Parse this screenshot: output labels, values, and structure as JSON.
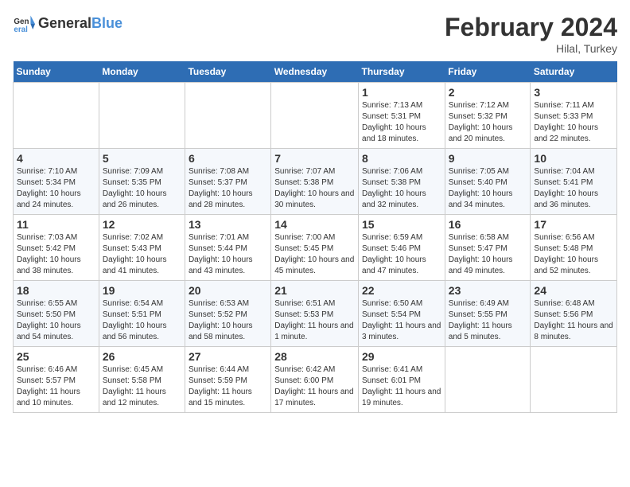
{
  "header": {
    "logo_general": "General",
    "logo_blue": "Blue",
    "month_title": "February 2024",
    "location": "Hilal, Turkey"
  },
  "days_of_week": [
    "Sunday",
    "Monday",
    "Tuesday",
    "Wednesday",
    "Thursday",
    "Friday",
    "Saturday"
  ],
  "weeks": [
    [
      {
        "day": "",
        "sunrise": "",
        "sunset": "",
        "daylight": ""
      },
      {
        "day": "",
        "sunrise": "",
        "sunset": "",
        "daylight": ""
      },
      {
        "day": "",
        "sunrise": "",
        "sunset": "",
        "daylight": ""
      },
      {
        "day": "",
        "sunrise": "",
        "sunset": "",
        "daylight": ""
      },
      {
        "day": "1",
        "sunrise": "Sunrise: 7:13 AM",
        "sunset": "Sunset: 5:31 PM",
        "daylight": "Daylight: 10 hours and 18 minutes."
      },
      {
        "day": "2",
        "sunrise": "Sunrise: 7:12 AM",
        "sunset": "Sunset: 5:32 PM",
        "daylight": "Daylight: 10 hours and 20 minutes."
      },
      {
        "day": "3",
        "sunrise": "Sunrise: 7:11 AM",
        "sunset": "Sunset: 5:33 PM",
        "daylight": "Daylight: 10 hours and 22 minutes."
      }
    ],
    [
      {
        "day": "4",
        "sunrise": "Sunrise: 7:10 AM",
        "sunset": "Sunset: 5:34 PM",
        "daylight": "Daylight: 10 hours and 24 minutes."
      },
      {
        "day": "5",
        "sunrise": "Sunrise: 7:09 AM",
        "sunset": "Sunset: 5:35 PM",
        "daylight": "Daylight: 10 hours and 26 minutes."
      },
      {
        "day": "6",
        "sunrise": "Sunrise: 7:08 AM",
        "sunset": "Sunset: 5:37 PM",
        "daylight": "Daylight: 10 hours and 28 minutes."
      },
      {
        "day": "7",
        "sunrise": "Sunrise: 7:07 AM",
        "sunset": "Sunset: 5:38 PM",
        "daylight": "Daylight: 10 hours and 30 minutes."
      },
      {
        "day": "8",
        "sunrise": "Sunrise: 7:06 AM",
        "sunset": "Sunset: 5:38 PM",
        "daylight": "Daylight: 10 hours and 32 minutes."
      },
      {
        "day": "9",
        "sunrise": "Sunrise: 7:05 AM",
        "sunset": "Sunset: 5:40 PM",
        "daylight": "Daylight: 10 hours and 34 minutes."
      },
      {
        "day": "10",
        "sunrise": "Sunrise: 7:04 AM",
        "sunset": "Sunset: 5:41 PM",
        "daylight": "Daylight: 10 hours and 36 minutes."
      }
    ],
    [
      {
        "day": "11",
        "sunrise": "Sunrise: 7:03 AM",
        "sunset": "Sunset: 5:42 PM",
        "daylight": "Daylight: 10 hours and 38 minutes."
      },
      {
        "day": "12",
        "sunrise": "Sunrise: 7:02 AM",
        "sunset": "Sunset: 5:43 PM",
        "daylight": "Daylight: 10 hours and 41 minutes."
      },
      {
        "day": "13",
        "sunrise": "Sunrise: 7:01 AM",
        "sunset": "Sunset: 5:44 PM",
        "daylight": "Daylight: 10 hours and 43 minutes."
      },
      {
        "day": "14",
        "sunrise": "Sunrise: 7:00 AM",
        "sunset": "Sunset: 5:45 PM",
        "daylight": "Daylight: 10 hours and 45 minutes."
      },
      {
        "day": "15",
        "sunrise": "Sunrise: 6:59 AM",
        "sunset": "Sunset: 5:46 PM",
        "daylight": "Daylight: 10 hours and 47 minutes."
      },
      {
        "day": "16",
        "sunrise": "Sunrise: 6:58 AM",
        "sunset": "Sunset: 5:47 PM",
        "daylight": "Daylight: 10 hours and 49 minutes."
      },
      {
        "day": "17",
        "sunrise": "Sunrise: 6:56 AM",
        "sunset": "Sunset: 5:48 PM",
        "daylight": "Daylight: 10 hours and 52 minutes."
      }
    ],
    [
      {
        "day": "18",
        "sunrise": "Sunrise: 6:55 AM",
        "sunset": "Sunset: 5:50 PM",
        "daylight": "Daylight: 10 hours and 54 minutes."
      },
      {
        "day": "19",
        "sunrise": "Sunrise: 6:54 AM",
        "sunset": "Sunset: 5:51 PM",
        "daylight": "Daylight: 10 hours and 56 minutes."
      },
      {
        "day": "20",
        "sunrise": "Sunrise: 6:53 AM",
        "sunset": "Sunset: 5:52 PM",
        "daylight": "Daylight: 10 hours and 58 minutes."
      },
      {
        "day": "21",
        "sunrise": "Sunrise: 6:51 AM",
        "sunset": "Sunset: 5:53 PM",
        "daylight": "Daylight: 11 hours and 1 minute."
      },
      {
        "day": "22",
        "sunrise": "Sunrise: 6:50 AM",
        "sunset": "Sunset: 5:54 PM",
        "daylight": "Daylight: 11 hours and 3 minutes."
      },
      {
        "day": "23",
        "sunrise": "Sunrise: 6:49 AM",
        "sunset": "Sunset: 5:55 PM",
        "daylight": "Daylight: 11 hours and 5 minutes."
      },
      {
        "day": "24",
        "sunrise": "Sunrise: 6:48 AM",
        "sunset": "Sunset: 5:56 PM",
        "daylight": "Daylight: 11 hours and 8 minutes."
      }
    ],
    [
      {
        "day": "25",
        "sunrise": "Sunrise: 6:46 AM",
        "sunset": "Sunset: 5:57 PM",
        "daylight": "Daylight: 11 hours and 10 minutes."
      },
      {
        "day": "26",
        "sunrise": "Sunrise: 6:45 AM",
        "sunset": "Sunset: 5:58 PM",
        "daylight": "Daylight: 11 hours and 12 minutes."
      },
      {
        "day": "27",
        "sunrise": "Sunrise: 6:44 AM",
        "sunset": "Sunset: 5:59 PM",
        "daylight": "Daylight: 11 hours and 15 minutes."
      },
      {
        "day": "28",
        "sunrise": "Sunrise: 6:42 AM",
        "sunset": "Sunset: 6:00 PM",
        "daylight": "Daylight: 11 hours and 17 minutes."
      },
      {
        "day": "29",
        "sunrise": "Sunrise: 6:41 AM",
        "sunset": "Sunset: 6:01 PM",
        "daylight": "Daylight: 11 hours and 19 minutes."
      },
      {
        "day": "",
        "sunrise": "",
        "sunset": "",
        "daylight": ""
      },
      {
        "day": "",
        "sunrise": "",
        "sunset": "",
        "daylight": ""
      }
    ]
  ]
}
